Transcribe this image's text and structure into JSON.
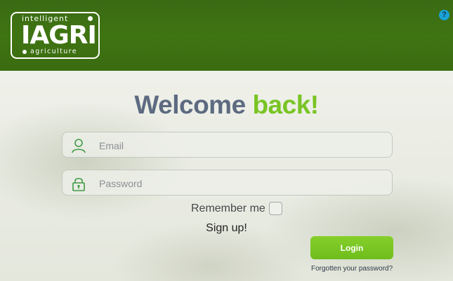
{
  "header": {
    "logo": {
      "top_text": "intelligent",
      "main_text": "IAGRI",
      "bottom_text": "agriculture"
    },
    "help_label": "?"
  },
  "main": {
    "title_part1": "Welcome",
    "title_part2": "back!",
    "email": {
      "placeholder": "Email",
      "value": "",
      "icon": "user-icon"
    },
    "password": {
      "placeholder": "Password",
      "value": "",
      "icon": "lock-icon"
    },
    "remember_label": "Remember me",
    "remember_checked": false,
    "signup_label": "Sign up!",
    "login_label": "Login",
    "forgot_label": "Forgotten your password?"
  },
  "colors": {
    "header_green": "#3f7412",
    "accent_green": "#79c424",
    "title_gray": "#5d6a80",
    "help_blue": "#1aa2d8"
  }
}
